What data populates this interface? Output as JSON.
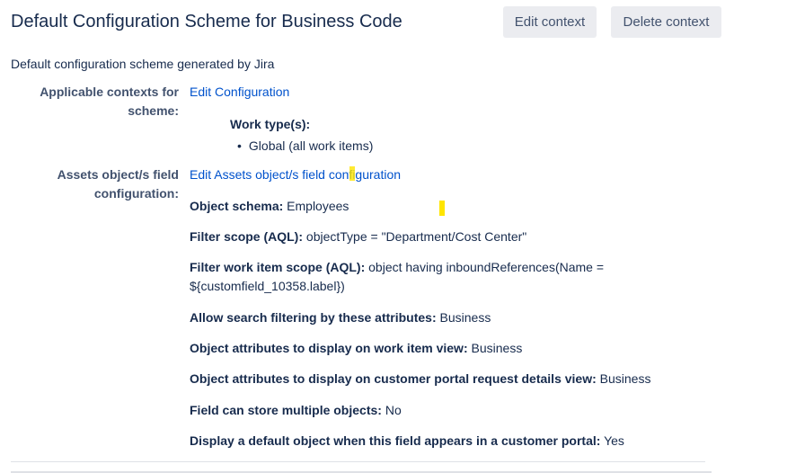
{
  "header": {
    "title": "Default Configuration Scheme for Business Code",
    "edit_context_label": "Edit context",
    "delete_context_label": "Delete context"
  },
  "description": "Default configuration scheme generated by Jira",
  "applicable_contexts": {
    "label_line1": "Applicable contexts for",
    "label_line2": "scheme:",
    "link": "Edit Configuration",
    "work_types_heading": "Work type(s):",
    "work_types": [
      "Global (all work items)"
    ]
  },
  "assets_config": {
    "label_line1": "Assets object/s field",
    "label_line2": "configuration:",
    "link": "Edit Assets object/s field configuration",
    "fields": [
      {
        "key": "Object schema:",
        "value": "Employees"
      },
      {
        "key": "Filter scope (AQL):",
        "value": "objectType = \"Department/Cost Center\""
      },
      {
        "key": "Filter work item scope (AQL):",
        "value": "object having inboundReferences(Name =",
        "value_line2": "${customfield_10358.label})"
      },
      {
        "key": "Allow search filtering by these attributes:",
        "value": "Business"
      },
      {
        "key": "Object attributes to display on work item view:",
        "value": "Business"
      },
      {
        "key": "Object attributes to display on customer portal request details view:",
        "value": "Business"
      },
      {
        "key": "Field can store multiple objects:",
        "value": "No"
      },
      {
        "key": "Display a default object when this field appears in a customer portal:",
        "value": "Yes"
      }
    ]
  },
  "colors": {
    "link": "#0052cc",
    "text": "#172b4d",
    "label": "#42526e",
    "button_bg": "#ebecf0",
    "highlight": "#ffe500"
  }
}
